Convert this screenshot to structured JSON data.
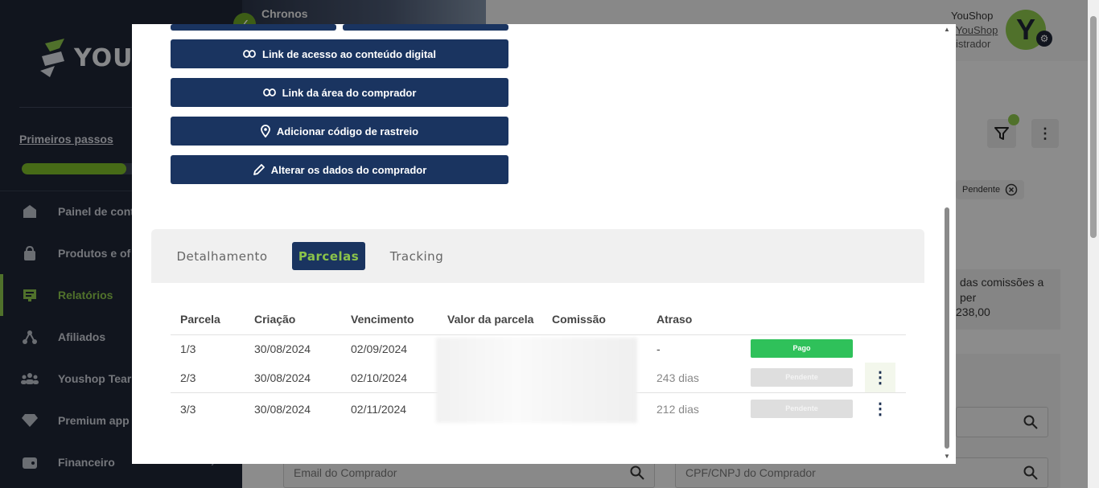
{
  "sidebar": {
    "logo_text": "YOUS",
    "first_steps": "Primeiros passos",
    "progress_fraction": 0.52,
    "items": [
      {
        "label": "Painel de cont",
        "icon": "dashboard-icon"
      },
      {
        "label": "Produtos e of",
        "icon": "bag-icon"
      },
      {
        "label": "Relatórios",
        "icon": "report-icon",
        "active": true
      },
      {
        "label": "Afiliados",
        "icon": "affiliates-icon"
      },
      {
        "label": "Youshop Tear",
        "icon": "team-icon"
      },
      {
        "label": "Premium app",
        "icon": "diamond-icon"
      },
      {
        "label": "Financeiro",
        "icon": "wallet-icon"
      }
    ]
  },
  "header": {
    "product_name": "Chronos",
    "user_name": "YouShop",
    "user_link": "YouShop",
    "user_role": "istrador",
    "avatar_letter": "Y"
  },
  "filters": {
    "chip_label": "Pendente",
    "panel_title_line1": "das comissões a",
    "panel_title_line2": "per",
    "panel_value": "238,00",
    "email_placeholder": "Email do Comprador",
    "cpf_placeholder": "CPF/CNPJ do Comprador"
  },
  "modal": {
    "actions": [
      {
        "label": "Link de acesso ao conteúdo digital",
        "icon": "link-icon"
      },
      {
        "label": "Link da área do comprador",
        "icon": "link-icon"
      },
      {
        "label": "Adicionar código de rastreio",
        "icon": "location-pin-icon"
      },
      {
        "label": "Alterar os dados do comprador",
        "icon": "pencil-icon"
      }
    ],
    "tabs": [
      "Detalhamento",
      "Parcelas",
      "Tracking"
    ],
    "active_tab": "Parcelas",
    "table": {
      "headers": [
        "Parcela",
        "Criação",
        "Vencimento",
        "Valor da parcela",
        "Comissão",
        "Atraso"
      ],
      "rows": [
        {
          "parcela": "1/3",
          "criacao": "30/08/2024",
          "vencimento": "02/09/2024",
          "atraso": "-",
          "status": "Pago"
        },
        {
          "parcela": "2/3",
          "criacao": "30/08/2024",
          "vencimento": "02/10/2024",
          "atraso": "243 dias",
          "status": "Pendente"
        },
        {
          "parcela": "3/3",
          "criacao": "30/08/2024",
          "vencimento": "02/11/2024",
          "atraso": "212 dias",
          "status": "Pendente"
        }
      ]
    }
  },
  "colors": {
    "navy": "#1a3460",
    "accent_green": "#8bc34a",
    "paid_green": "#2fc15a",
    "sidebar_bg": "#1e2535"
  }
}
